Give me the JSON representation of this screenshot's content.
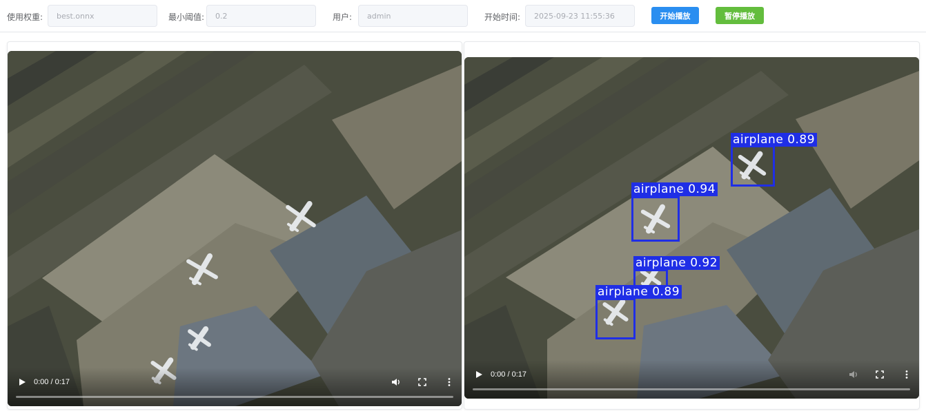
{
  "toolbar": {
    "weights_label": "使用权重:",
    "weights_value": "best.onnx",
    "threshold_label": "最小阈值:",
    "threshold_value": "0.2",
    "user_label": "用户:",
    "user_value": "admin",
    "start_time_label": "开始时间:",
    "start_time_value": "2025-09-23 11:55:36",
    "start_button": "开始播放",
    "pause_button": "暂停播放"
  },
  "original_video": {
    "time": "0:00 / 0:17",
    "progress": 0
  },
  "result_video": {
    "time": "0:00 / 0:17",
    "progress": 0,
    "detections": [
      {
        "label": "airplane 0.89"
      },
      {
        "label": "airplane 0.94"
      },
      {
        "label": "airplane 0.92"
      },
      {
        "label": "airplane 0.89"
      }
    ]
  },
  "colors": {
    "start_button": "#2a8ef0",
    "pause_button": "#63bd3d",
    "detection": "#1f2ee6"
  }
}
